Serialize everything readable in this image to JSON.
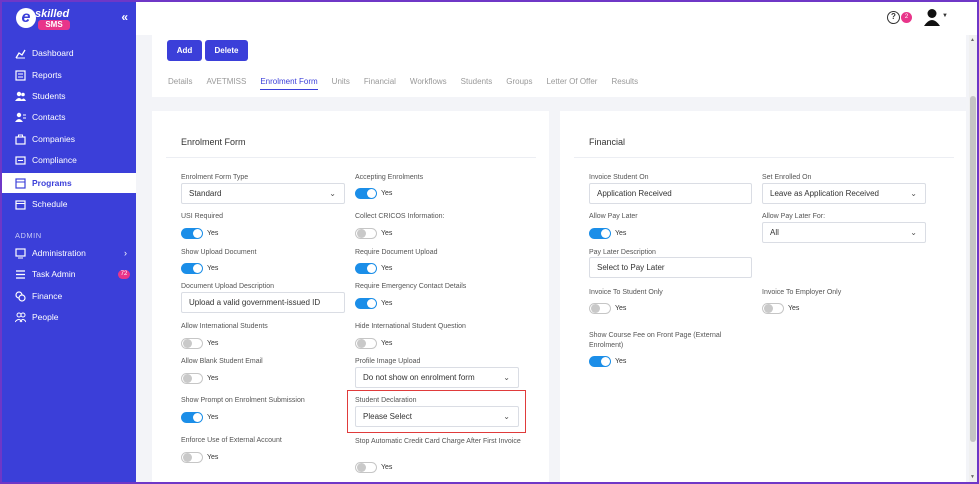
{
  "brand": {
    "logo_e": "e",
    "logo_skilled": "skilled",
    "logo_sms": "SMS"
  },
  "sidebar": {
    "items": [
      {
        "label": "Dashboard",
        "icon": "chart-line-icon"
      },
      {
        "label": "Reports",
        "icon": "report-icon"
      },
      {
        "label": "Students",
        "icon": "users-icon"
      },
      {
        "label": "Contacts",
        "icon": "contacts-icon"
      },
      {
        "label": "Companies",
        "icon": "briefcase-icon"
      },
      {
        "label": "Compliance",
        "icon": "compliance-icon"
      },
      {
        "label": "Programs",
        "icon": "programs-icon"
      },
      {
        "label": "Schedule",
        "icon": "calendar-icon"
      }
    ],
    "section_admin": "ADMIN",
    "admin_items": [
      {
        "label": "Administration",
        "icon": "monitor-icon"
      },
      {
        "label": "Task Admin",
        "icon": "list-icon",
        "badge": "72"
      },
      {
        "label": "Finance",
        "icon": "coins-icon"
      },
      {
        "label": "People",
        "icon": "people-icon"
      }
    ]
  },
  "topbar": {
    "help_badge": "2"
  },
  "toolbar": {
    "add": "Add",
    "delete": "Delete"
  },
  "tabs": [
    "Details",
    "AVETMISS",
    "Enrolment Form",
    "Units",
    "Financial",
    "Workflows",
    "Students",
    "Groups",
    "Letter Of Offer",
    "Results"
  ],
  "enrolment": {
    "title": "Enrolment Form",
    "form_type_label": "Enrolment Form Type",
    "form_type_value": "Standard",
    "accepting_label": "Accepting Enrolments",
    "usi_label": "USI Required",
    "cricos_label": "Collect CRICOS Information:",
    "show_upload_label": "Show Upload Document",
    "require_upload_label": "Require Document Upload",
    "doc_desc_label": "Document Upload Description",
    "doc_desc_value": "Upload a valid government-issued ID",
    "emergency_label": "Require Emergency Contact Details",
    "intl_label": "Allow International Students",
    "hide_intl_label": "Hide International Student Question",
    "blank_email_label": "Allow Blank Student Email",
    "profile_label": "Profile Image Upload",
    "profile_value": "Do not show on enrolment form",
    "prompt_label": "Show Prompt on Enrolment Submission",
    "declaration_label": "Student Declaration",
    "declaration_value": "Please Select",
    "external_label": "Enforce Use of External Account",
    "stop_cc_label": "Stop Automatic Credit Card Charge After First Invoice",
    "yes": "Yes"
  },
  "financial": {
    "title": "Financial",
    "invoice_on_label": "Invoice Student On",
    "invoice_on_value": "Application Received",
    "set_enrolled_label": "Set Enrolled On",
    "set_enrolled_value": "Leave as Application Received",
    "pay_later_label": "Allow Pay Later",
    "pay_later_for_label": "Allow Pay Later For:",
    "pay_later_for_value": "All",
    "pay_later_desc_label": "Pay Later Description",
    "pay_later_desc_value": "Select to Pay Later",
    "invoice_student_label": "Invoice To Student Only",
    "invoice_employer_label": "Invoice To Employer Only",
    "course_fee_label": "Show Course Fee on Front Page (External Enrolment)",
    "yes": "Yes"
  },
  "colors": {
    "primary": "#3b3fd9",
    "toggle_on": "#1b8ee8",
    "badge": "#e8358a",
    "highlight": "#e03b3b"
  }
}
